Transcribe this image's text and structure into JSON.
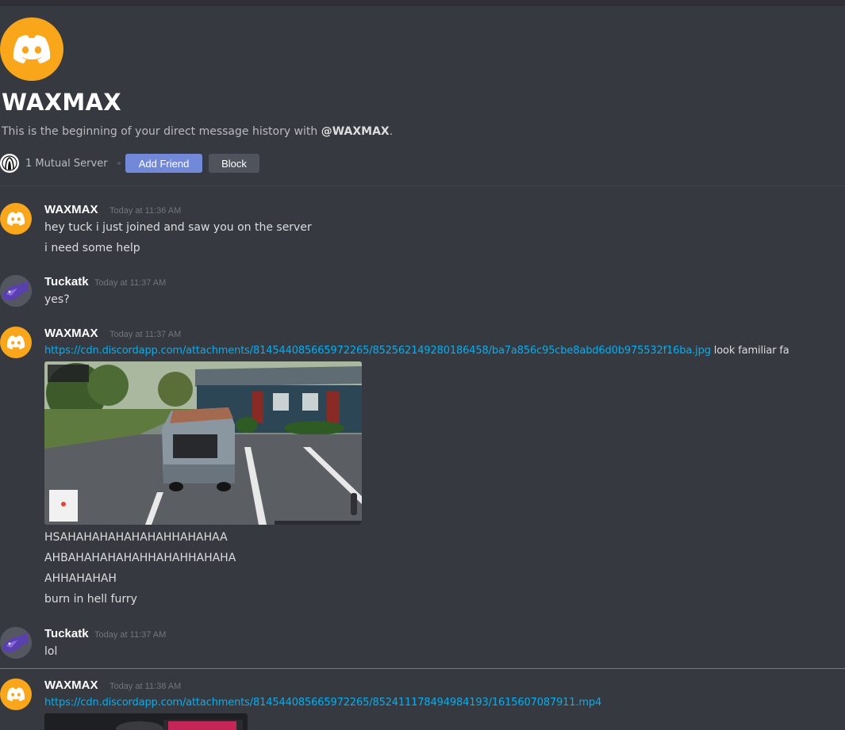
{
  "header": {
    "name": "WAXMAX",
    "intro_prefix": "This is the beginning of your direct message history with ",
    "intro_mention": "@WAXMAX",
    "intro_suffix": ".",
    "mutual_servers": "1 Mutual Server",
    "add_friend_label": "Add Friend",
    "block_label": "Block"
  },
  "messages": [
    {
      "author": "WAXMAX",
      "timestamp": "Today at 11:36 AM",
      "lines": [
        "hey tuck i just joined and saw you on the server",
        "i need some help"
      ]
    },
    {
      "author": "Tuckatk",
      "timestamp": "Today at 11:37 AM",
      "lines": [
        "yes?"
      ]
    },
    {
      "author": "WAXMAX",
      "timestamp": "Today at 11:37 AM",
      "link": "https://cdn.discordapp.com/attachments/814544085665972265/852562149280186458/ba7a856c95cbe8abd6d0b975532f16ba.jpg",
      "link_suffix": " look familiar fa",
      "lines": [
        "HSAHAHAHAHAHAHAHHAHAHAA",
        "AHBAHAHAHAHAHHAHAHHAHAHA",
        "AHHAHAHAH",
        "burn in hell furry"
      ]
    },
    {
      "author": "Tuckatk",
      "timestamp": "Today at 11:37 AM",
      "lines": [
        "lol"
      ]
    },
    {
      "author": "WAXMAX",
      "timestamp": "Today at 11:38 AM",
      "link": "https://cdn.discordapp.com/attachments/814544085665972265/852411178494984193/1615607087911.mp4"
    }
  ],
  "colors": {
    "background": "#36393f",
    "accent": "#7289da",
    "link": "#00b0f4",
    "discord_avatar": "#faa61a",
    "new_messages_line": "#f04747"
  }
}
